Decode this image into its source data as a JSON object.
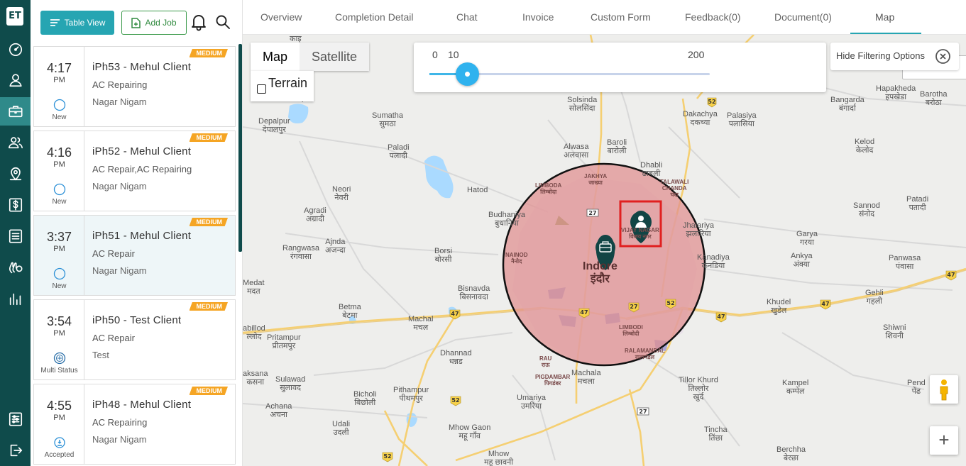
{
  "rail": {
    "logo": "ET",
    "items": [
      {
        "icon": "dashboard-icon"
      },
      {
        "icon": "user-icon"
      },
      {
        "icon": "briefcase-icon",
        "active": true
      },
      {
        "icon": "users-icon"
      },
      {
        "icon": "map-pin-icon"
      },
      {
        "icon": "dollar-icon"
      },
      {
        "icon": "list-icon"
      },
      {
        "icon": "hands-icon"
      },
      {
        "icon": "bar-chart-icon"
      },
      {
        "icon": "settings-sliders-icon"
      },
      {
        "icon": "logout-icon"
      }
    ]
  },
  "toolbar": {
    "table_view_label": "Table View",
    "add_job_label": "Add Job"
  },
  "jobs": [
    {
      "time": "4:17",
      "ampm": "PM",
      "title": "iPh53 - Mehul Client",
      "service": "AC Repairing",
      "location": "Nagar Nigam",
      "priority": "MEDIUM",
      "status": "New",
      "status_icon": "circle-icon",
      "selected": false
    },
    {
      "time": "4:16",
      "ampm": "PM",
      "title": "iPh52 - Mehul Client",
      "service": "AC Repair,AC Repairing",
      "location": "Nagar Nigam",
      "priority": "MEDIUM",
      "status": "New",
      "status_icon": "circle-icon",
      "selected": false
    },
    {
      "time": "3:37",
      "ampm": "PM",
      "title": "iPh51 - Mehul Client",
      "service": "AC Repair",
      "location": "Nagar Nigam",
      "priority": "MEDIUM",
      "status": "New",
      "status_icon": "circle-icon",
      "selected": true
    },
    {
      "time": "3:54",
      "ampm": "PM",
      "title": "iPh50 - Test Client",
      "service": "AC Repair",
      "location": "Test",
      "priority": "MEDIUM",
      "status": "Multi Status",
      "status_icon": "multi-status-icon",
      "selected": false
    },
    {
      "time": "4:55",
      "ampm": "PM",
      "title": "iPh48 - Mehul Client",
      "service": "AC Repairing",
      "location": "Nagar Nigam",
      "priority": "MEDIUM",
      "status": "Accepted",
      "status_icon": "accepted-icon",
      "selected": false
    }
  ],
  "tabs": [
    {
      "label": "Overview"
    },
    {
      "label": "Completion Detail"
    },
    {
      "label": "Chat"
    },
    {
      "label": "Invoice"
    },
    {
      "label": "Custom Form"
    },
    {
      "label": "Feedback(0)"
    },
    {
      "label": "Document(0)"
    },
    {
      "label": "Map",
      "active": true
    }
  ],
  "map": {
    "map_type_map": "Map",
    "map_type_satellite": "Satellite",
    "terrain_label": "Terrain",
    "slider": {
      "min": "0",
      "max": "200",
      "value": "10",
      "value_num": 10,
      "min_num": 0,
      "max_num": 200
    },
    "unit_selected": "Meter",
    "hide_filter_label": "Hide Filtering Options",
    "zoom_in_label": "+",
    "colors": {
      "radius_fill": "#e08f8f",
      "radius_stroke": "#111111",
      "marker": "#124545",
      "highlight": "#e02020"
    },
    "places": [
      {
        "text": "काइ"
      },
      {
        "text": "Depalpur\nदेपालपुर"
      },
      {
        "text": "बनोड़ा"
      },
      {
        "text": "Sumatha\nसुमठा"
      },
      {
        "text": "Paladi\nपलादी"
      },
      {
        "text": "Solsinda\nसोलसिंदा"
      },
      {
        "text": "Alwasa\nअलवासा"
      },
      {
        "text": "Baroli\nबारोली"
      },
      {
        "text": "Dakachya\nदकच्या"
      },
      {
        "text": "Palasiya\nपलासिया"
      },
      {
        "text": "Bangarda\nबंगार्दा"
      },
      {
        "text": "Hapakheda\nहपखेडा"
      },
      {
        "text": "Barotha\nबरोठा"
      },
      {
        "text": "Kelod\nकेलोद"
      },
      {
        "text": "Dhabli\nढाबली"
      },
      {
        "text": "Neori\nनेवरी"
      },
      {
        "text": "Hatod"
      },
      {
        "text": "Agradi\nअग्रादी"
      },
      {
        "text": "Budhaniya\nबुधानिया"
      },
      {
        "text": "Ajnda\nअजन्दा"
      },
      {
        "text": "Rangwasa\nरंगवासा"
      },
      {
        "text": "Borsi\nबोरसी"
      },
      {
        "text": "Sannod\nसंनोद"
      },
      {
        "text": "Patadi\nपतादी"
      },
      {
        "text": "Jhalariya\nझलारिया"
      },
      {
        "text": "Garya\nगरया"
      },
      {
        "text": "Kanadiya\nकनडिया"
      },
      {
        "text": "Ankya\nअंक्या"
      },
      {
        "text": "Panwasa\nपंवासा"
      },
      {
        "text": "Bisnavda\nबिसनावदा"
      },
      {
        "text": "Betma\nबेटमा"
      },
      {
        "text": "Machal\nमचल"
      },
      {
        "text": "Gehli\nगहली"
      },
      {
        "text": "Khudel\nखुडेल"
      },
      {
        "text": "Pritampur\nप्रीतमपुर"
      },
      {
        "text": "abillod\nल्लोद"
      },
      {
        "text": "Dhannad\nधन्नड"
      },
      {
        "text": "Shiwni\nशिवनी"
      },
      {
        "text": "Medat\nमदत"
      },
      {
        "text": "Sulawad\nसुलावद"
      },
      {
        "text": "aksana\nकसना"
      },
      {
        "text": "Machala\nमचला"
      },
      {
        "text": "Tillor Khurd\nतिल्लोर\nखुर्द"
      },
      {
        "text": "Kampel\nकम्पेल"
      },
      {
        "text": "Pend\nपेंढ"
      },
      {
        "text": "Pithampur\nपीथमपुर"
      },
      {
        "text": "Bicholi\nबिछोली"
      },
      {
        "text": "Umariya\nउमरिया"
      },
      {
        "text": "Achana\nअचना"
      },
      {
        "text": "Udali\nउदली"
      },
      {
        "text": "Mhow Gaon\nमहू गाँव"
      },
      {
        "text": "Tincha\nतिंछा"
      },
      {
        "text": "Berchha\nबेरछा"
      },
      {
        "text": "Mhow\nमहू छावनी"
      }
    ],
    "city": {
      "text": "Indore\nइंदौर"
    },
    "city_labels": [
      {
        "text": "JAKHYA\nजाख्या"
      },
      {
        "text": "LIMBODA\nलिम्बोदा"
      },
      {
        "text": "TALAWALI\nCHANDA\nचंदा"
      },
      {
        "text": "NAINOD\nनैनोद"
      },
      {
        "text": "VIJAY NAGAR\nविजय नगर"
      },
      {
        "text": "LIMBODI\nलिम्बोदी"
      },
      {
        "text": "RALAMANDAL\nरालामंडल"
      },
      {
        "text": "RAU\nराऊ"
      },
      {
        "text": "PIGDAMBAR\nपिगडंबर"
      }
    ],
    "road_shields": [
      "52",
      "27",
      "47",
      "47",
      "47",
      "47",
      "47",
      "52",
      "52",
      "52",
      "27",
      "52"
    ]
  }
}
